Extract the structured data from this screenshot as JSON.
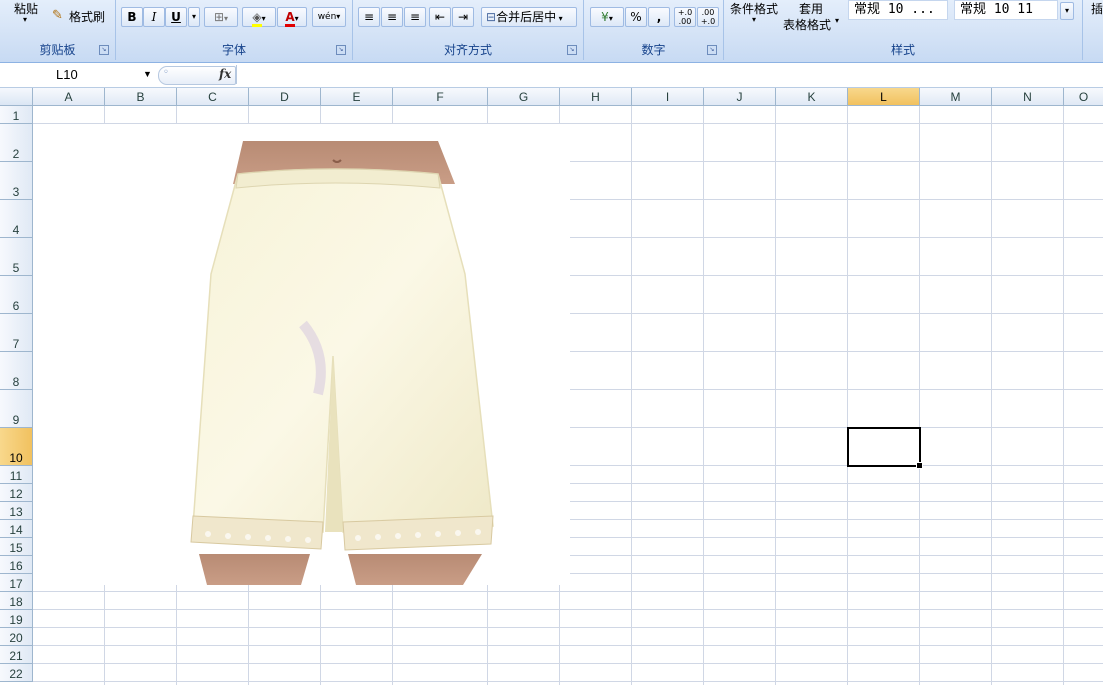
{
  "ribbon": {
    "clipboard": {
      "paste_label": "粘贴",
      "format_painter_label": "格式刷",
      "group_label": "剪贴板"
    },
    "font": {
      "bold": "B",
      "italic": "I",
      "underline": "U",
      "font_color_glyph": "A",
      "phonetic_glyph": "wén",
      "group_label": "字体"
    },
    "alignment": {
      "merge_center_label": "合并后居中",
      "group_label": "对齐方式"
    },
    "number": {
      "percent": "%",
      "comma": ",",
      "increase_decimal": "+.0\n.00",
      "decrease_decimal": ".00\n+.0",
      "group_label": "数字"
    },
    "styles": {
      "conditional_format_label": "条件格式",
      "table_format_line1": "套用",
      "table_format_line2": "表格格式",
      "style1": "常规 10 ...",
      "style2": "常规 10 11",
      "group_label": "样式"
    }
  },
  "formula_bar": {
    "name_box": "L10",
    "fx_label": "fx",
    "formula": ""
  },
  "grid": {
    "columns": [
      "A",
      "B",
      "C",
      "D",
      "E",
      "F",
      "G",
      "H",
      "I",
      "J",
      "K",
      "L",
      "M",
      "N",
      "O"
    ],
    "rows": [
      "1",
      "2",
      "3",
      "4",
      "5",
      "6",
      "7",
      "8",
      "9",
      "10",
      "11",
      "12",
      "13",
      "14",
      "15",
      "16",
      "17",
      "18",
      "19",
      "20",
      "21",
      "22"
    ],
    "selected_cell": "L10",
    "selected_column": "L",
    "selected_row": "10"
  },
  "picture": {
    "subject": "cream-colored lace-trimmed shorts"
  }
}
